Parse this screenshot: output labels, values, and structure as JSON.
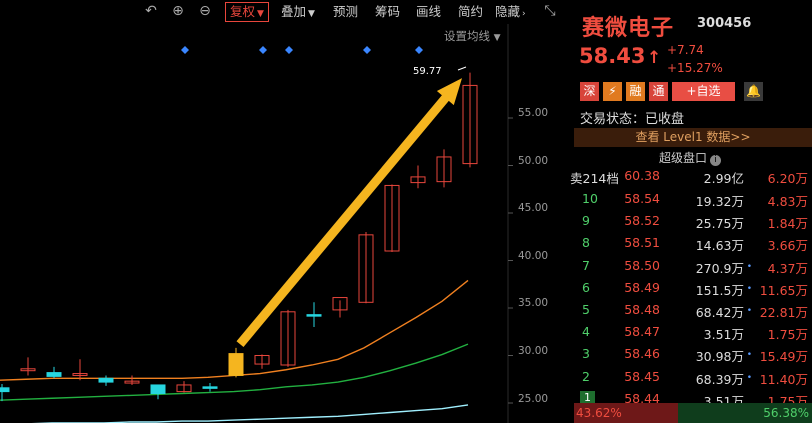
{
  "toolbar": {
    "undo_icon": "undo-icon",
    "zoom_in_icon": "zoom-in-icon",
    "zoom_out_icon": "zoom-out-icon",
    "items": [
      {
        "label": "复权",
        "active": true,
        "caret": "▼"
      },
      {
        "label": "叠加",
        "active": false,
        "caret": "▼"
      },
      {
        "label": "预测",
        "active": false,
        "caret": ""
      },
      {
        "label": "筹码",
        "active": false,
        "caret": ""
      },
      {
        "label": "画线",
        "active": false,
        "caret": ""
      },
      {
        "label": "简约",
        "active": false,
        "caret": ""
      },
      {
        "label": "隐藏",
        "active": false,
        "caret": "›"
      }
    ],
    "collapse_icon": "collapse-icon"
  },
  "chart": {
    "ma_setting_label": "设置均线",
    "ma_setting_caret": "▼",
    "peak_label": "59.77",
    "yticks": [
      "55.00",
      "50.00",
      "45.00",
      "40.00",
      "35.00",
      "30.00",
      "25.00"
    ],
    "colors": {
      "up": "#e8463c",
      "down": "#27d6e0",
      "ma5": "#ffffff",
      "ma10": "#f08020",
      "ma20": "#22b040",
      "ma60": "#a0f0ff",
      "arrow": "#f5b51f",
      "marker": "#3a86ff"
    }
  },
  "chart_data": {
    "type": "candlestick",
    "ylim": [
      23.5,
      62
    ],
    "yticks": [
      25,
      30,
      35,
      40,
      45,
      50,
      55
    ],
    "candles": [
      {
        "o": 26.2,
        "h": 27.0,
        "l": 25.2,
        "c": 26.6,
        "dir": "down"
      },
      {
        "o": 28.4,
        "h": 29.8,
        "l": 27.9,
        "c": 28.6,
        "dir": "up"
      },
      {
        "o": 28.2,
        "h": 28.8,
        "l": 27.6,
        "c": 27.8,
        "dir": "down"
      },
      {
        "o": 28.1,
        "h": 29.6,
        "l": 27.4,
        "c": 27.9,
        "dir": "up"
      },
      {
        "o": 27.6,
        "h": 27.9,
        "l": 26.8,
        "c": 27.2,
        "dir": "down"
      },
      {
        "o": 27.1,
        "h": 27.9,
        "l": 26.9,
        "c": 27.3,
        "dir": "up"
      },
      {
        "o": 26.0,
        "h": 26.8,
        "l": 25.4,
        "c": 26.9,
        "dir": "down"
      },
      {
        "o": 26.9,
        "h": 27.3,
        "l": 26.1,
        "c": 26.2,
        "dir": "up"
      },
      {
        "o": 26.7,
        "h": 27.1,
        "l": 26.2,
        "c": 26.6,
        "dir": "down"
      },
      {
        "o": 27.9,
        "h": 30.8,
        "l": 27.7,
        "c": 30.2,
        "dir": "yellow"
      },
      {
        "o": 29.1,
        "h": 30.1,
        "l": 28.6,
        "c": 30.0,
        "dir": "up"
      },
      {
        "o": 29.0,
        "h": 34.8,
        "l": 28.8,
        "c": 34.6,
        "dir": "up"
      },
      {
        "o": 34.2,
        "h": 35.6,
        "l": 33.0,
        "c": 34.3,
        "dir": "cross"
      },
      {
        "o": 34.8,
        "h": 35.8,
        "l": 34.0,
        "c": 36.1,
        "dir": "up"
      },
      {
        "o": 35.6,
        "h": 43.0,
        "l": 35.5,
        "c": 42.7,
        "dir": "up"
      },
      {
        "o": 41.0,
        "h": 48.0,
        "l": 40.9,
        "c": 47.9,
        "dir": "up"
      },
      {
        "o": 48.2,
        "h": 50.0,
        "l": 47.6,
        "c": 48.8,
        "dir": "up"
      },
      {
        "o": 48.3,
        "h": 51.7,
        "l": 47.7,
        "c": 50.9,
        "dir": "up"
      },
      {
        "o": 50.2,
        "h": 59.77,
        "l": 49.8,
        "c": 58.43,
        "dir": "up"
      }
    ],
    "ma10": [
      27.4,
      27.5,
      27.6,
      27.6,
      27.6,
      27.6,
      27.6,
      27.6,
      27.7,
      27.9,
      28.1,
      28.5,
      29.0,
      29.6,
      30.8,
      32.4,
      34.0,
      35.7,
      37.9
    ],
    "ma20": [
      25.3,
      25.4,
      25.5,
      25.6,
      25.7,
      25.8,
      25.9,
      26.0,
      26.1,
      26.2,
      26.4,
      26.7,
      26.9,
      27.2,
      27.7,
      28.4,
      29.2,
      30.1,
      31.2
    ],
    "ma60": [
      22.8,
      22.8,
      22.9,
      22.9,
      22.9,
      23.0,
      23.0,
      23.1,
      23.1,
      23.2,
      23.3,
      23.4,
      23.5,
      23.6,
      23.8,
      24.0,
      24.2,
      24.4,
      24.8
    ],
    "markers": [
      7,
      10,
      11,
      14,
      16
    ]
  },
  "quote": {
    "name": "赛微电子",
    "code": "300456",
    "price": "58.43",
    "arrow": "↑",
    "change": "+7.74",
    "change_pct": "+15.27%",
    "tags": [
      "深",
      "⚡",
      "融",
      "通",
      "+自选"
    ],
    "status": "交易状态：已收盘",
    "level1": "查看 Level1 数据>>",
    "super_label": "超级盘口",
    "super_info": "i"
  },
  "orderbook": {
    "sell_header": {
      "label": "卖214档",
      "price": "60.38",
      "vol": "2.99亿",
      "amt": "6.20万"
    },
    "rows": [
      {
        "level": "10",
        "price": "58.54",
        "vol": "19.32万",
        "amt": "4.83万",
        "mark": ""
      },
      {
        "level": "9",
        "price": "58.52",
        "vol": "25.75万",
        "amt": "1.84万",
        "mark": ""
      },
      {
        "level": "8",
        "price": "58.51",
        "vol": "14.63万",
        "amt": "3.66万",
        "mark": ""
      },
      {
        "level": "7",
        "price": "58.50",
        "vol": "270.9万",
        "amt": "4.37万",
        "mark": "•"
      },
      {
        "level": "6",
        "price": "58.49",
        "vol": "151.5万",
        "amt": "11.65万",
        "mark": "•"
      },
      {
        "level": "5",
        "price": "58.48",
        "vol": "68.42万",
        "amt": "22.81万",
        "mark": "•"
      },
      {
        "level": "4",
        "price": "58.47",
        "vol": "3.51万",
        "amt": "1.75万",
        "mark": ""
      },
      {
        "level": "3",
        "price": "58.46",
        "vol": "30.98万",
        "amt": "15.49万",
        "mark": "•"
      },
      {
        "level": "2",
        "price": "58.45",
        "vol": "68.39万",
        "amt": "11.40万",
        "mark": "•"
      },
      {
        "level": "1",
        "price": "58.44",
        "vol": "3.51万",
        "amt": "1.75万",
        "mark": ""
      }
    ],
    "buy_ratio": "43.62%",
    "sell_ratio": "56.38%"
  }
}
